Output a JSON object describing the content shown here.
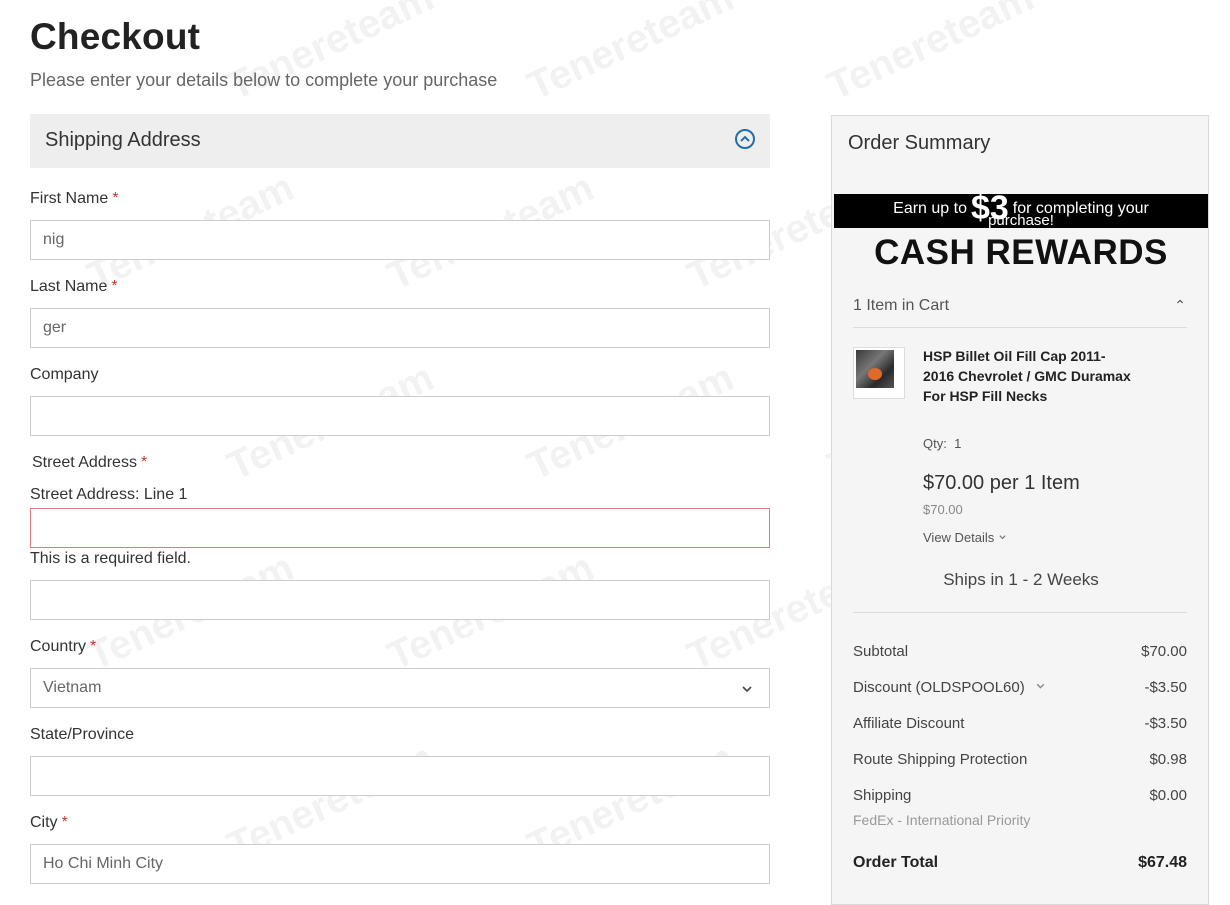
{
  "page": {
    "title": "Checkout",
    "subtitle": "Please enter your details below to complete your purchase"
  },
  "shipping": {
    "section_title": "Shipping Address",
    "required_mark": "*",
    "first_name": {
      "label": "First Name",
      "value": "nig"
    },
    "last_name": {
      "label": "Last Name",
      "value": "ger"
    },
    "company": {
      "label": "Company",
      "value": ""
    },
    "street": {
      "label": "Street Address",
      "line1_label": "Street Address: Line 1",
      "line1_value": "",
      "error": "This is a required field.",
      "line2_value": ""
    },
    "country": {
      "label": "Country",
      "value": "Vietnam"
    },
    "state": {
      "label": "State/Province",
      "value": ""
    },
    "city": {
      "label": "City",
      "value": "Ho Chi Minh City"
    }
  },
  "summary": {
    "title": "Order Summary",
    "promo": {
      "prefix": "Earn up to",
      "amount": "$3",
      "suffix": "for completing your",
      "line2": "purchase!",
      "headline": "CASH REWARDS"
    },
    "cart_count": "1 Item in Cart",
    "item": {
      "name": "HSP Billet Oil Fill Cap 2011-2016 Chevrolet / GMC Duramax For HSP Fill Necks",
      "qty_label": "Qty:",
      "qty": "1",
      "price_per": "$70.00 per 1 Item",
      "price": "$70.00",
      "view_details": "View Details"
    },
    "ships_in": "Ships in 1 - 2 Weeks",
    "totals": [
      {
        "label": "Subtotal",
        "value": "$70.00"
      },
      {
        "label": "Discount (OLDSPOOL60)",
        "value": "-$3.50"
      },
      {
        "label": "Affiliate Discount",
        "value": "-$3.50"
      },
      {
        "label": "Route Shipping Protection",
        "value": "$0.98"
      },
      {
        "label": "Shipping",
        "value": "$0.00"
      }
    ],
    "shipping_method": "FedEx - International Priority",
    "order_total": {
      "label": "Order Total",
      "value": "$67.48"
    }
  },
  "watermark": {
    "text": "Tenereteam"
  },
  "colors": {
    "accent": "#1f6fae",
    "required": "#c0392b",
    "error_border": "#e07a7a"
  }
}
